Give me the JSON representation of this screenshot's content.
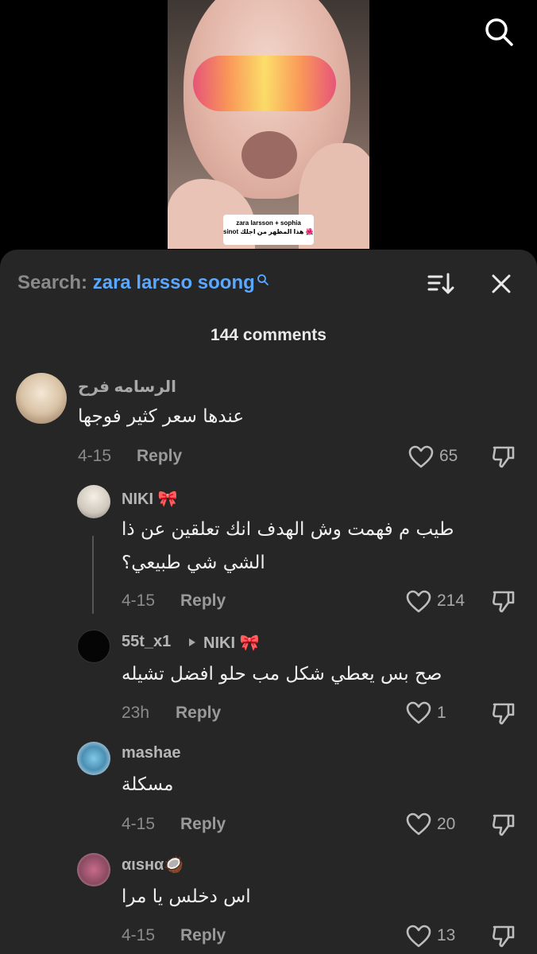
{
  "video": {
    "caption_line1": "zara larsson + sophia",
    "caption_line2": "sinot هذا المظهر من اجلك 🌺🌴🌴"
  },
  "header": {
    "search_prefix": "Search: ",
    "search_term": "zara larsso soong",
    "comment_count": "144 comments"
  },
  "comments": [
    {
      "username": "الرسامه فرح",
      "text": "عندها سعر كثير فوجها",
      "date": "4-15",
      "reply_label": "Reply",
      "likes": "65"
    },
    {
      "username": "NIKI 🎀",
      "text": "طيب م فهمت وش الهدف انك تعلقين عن ذا الشي شي طبيعي؟",
      "date": "4-15",
      "reply_label": "Reply",
      "likes": "214"
    },
    {
      "username": "55t_x1",
      "reply_to": "NIKI 🎀",
      "text": "صح بس يعطي شكل مب حلو افضل تشيله",
      "date": "23h",
      "reply_label": "Reply",
      "likes": "1"
    },
    {
      "username": "mashae",
      "text": "مسكلة",
      "date": "4-15",
      "reply_label": "Reply",
      "likes": "20"
    },
    {
      "username": "αιsнα🥥",
      "text": "اس دخلس يا مرا",
      "date": "4-15",
      "reply_label": "Reply",
      "likes": "13"
    }
  ],
  "colors": {
    "sheet_bg": "#262626",
    "accent_search": "#5aa8ff",
    "muted_text": "#8a8a8a"
  },
  "icons": [
    "search-icon",
    "sort-icon",
    "close-icon",
    "heart-icon",
    "dislike-icon",
    "play-triangle-icon"
  ]
}
